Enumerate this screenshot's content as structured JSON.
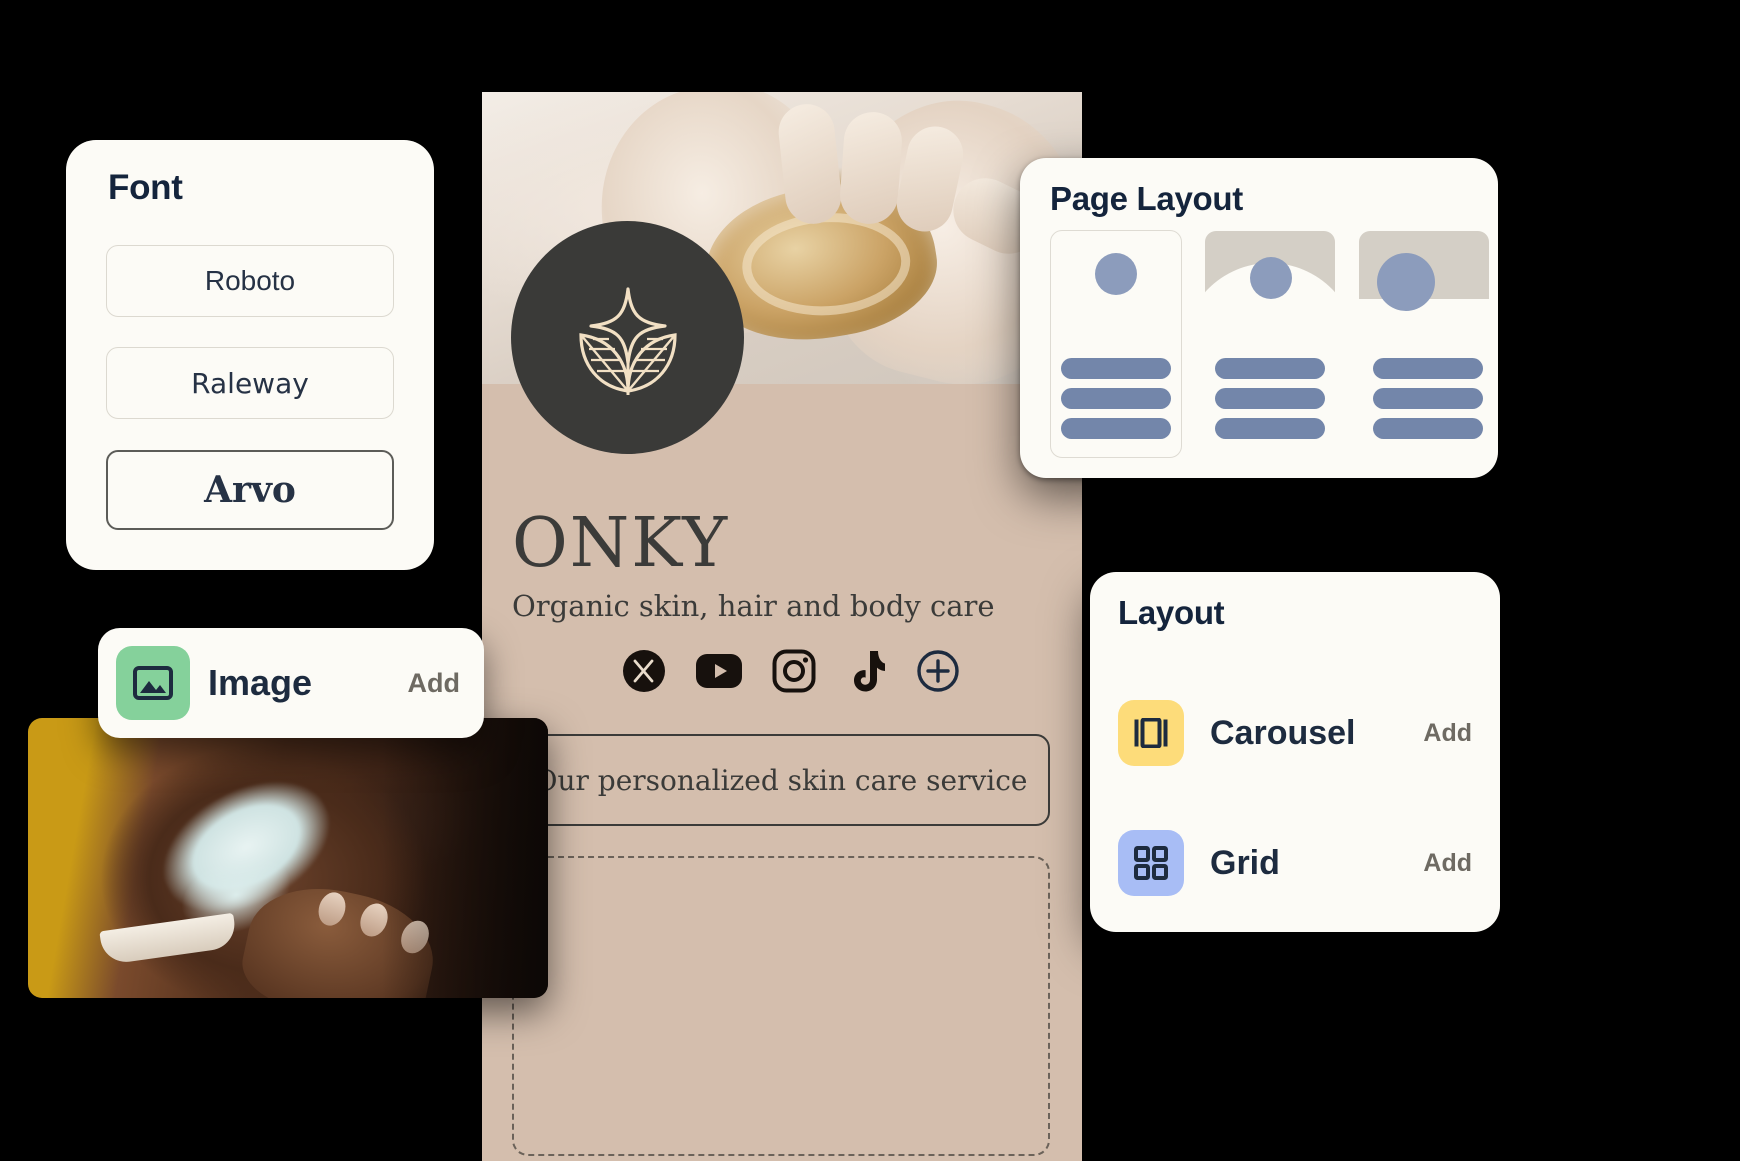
{
  "font_card": {
    "title": "Font",
    "options": [
      {
        "label": "Roboto",
        "selected": false
      },
      {
        "label": "Raleway",
        "selected": false
      },
      {
        "label": "Arvo",
        "selected": true
      }
    ]
  },
  "image_card": {
    "icon": "image-icon",
    "label": "Image",
    "add_label": "Add",
    "icon_color": "#85D19B"
  },
  "phone_preview": {
    "brand_name": "ONKY",
    "tagline": "Organic skin, hair and body care",
    "cta_label": "Our personalized skin care service",
    "logo_icon": "sparkle-leaves-logo",
    "background_color": "#D4BEAD",
    "logo_background": "#3A3A38",
    "logo_stroke": "#F2E0C4",
    "socials": [
      {
        "name": "x-icon",
        "label": "X"
      },
      {
        "name": "youtube-icon",
        "label": "YouTube"
      },
      {
        "name": "instagram-icon",
        "label": "Instagram"
      },
      {
        "name": "tiktok-icon",
        "label": "TikTok"
      },
      {
        "name": "add-social-icon",
        "label": "Add social"
      }
    ]
  },
  "page_layout_card": {
    "title": "Page Layout",
    "thumbs": [
      {
        "name": "layout-thumb-plain",
        "band": false,
        "arc": false,
        "selected": true,
        "lines": 3
      },
      {
        "name": "layout-thumb-arc",
        "band": true,
        "arc": true,
        "selected": false,
        "lines": 3
      },
      {
        "name": "layout-thumb-band",
        "band": true,
        "arc": false,
        "selected": false,
        "lines": 3
      }
    ],
    "colors": {
      "band": "#D4CFC6",
      "dot": "#8C9CBC",
      "line": "#7386AA"
    }
  },
  "layout_card": {
    "title": "Layout",
    "rows": [
      {
        "icon": "carousel-icon",
        "label": "Carousel",
        "add_label": "Add",
        "icon_bg": "#FDDC7A"
      },
      {
        "icon": "grid-icon",
        "label": "Grid",
        "add_label": "Add",
        "icon_bg": "#A8BDF5"
      }
    ]
  }
}
